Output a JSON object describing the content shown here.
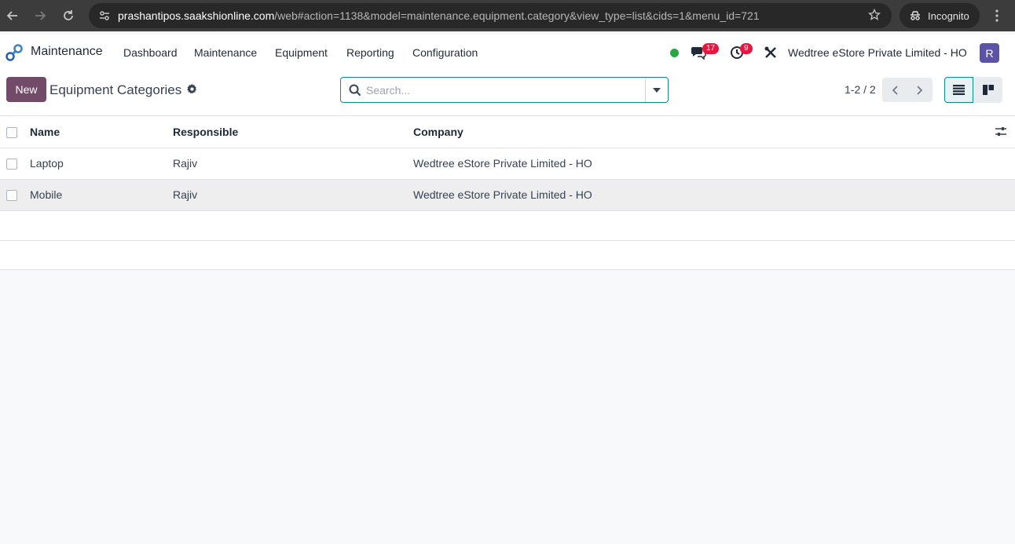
{
  "browser": {
    "url_host": "prashantipos.saakshionline.com",
    "url_path": "/web#action=1138&model=maintenance.equipment.category&view_type=list&cids=1&menu_id=721",
    "incognito_label": "Incognito"
  },
  "topnav": {
    "app_name": "Maintenance",
    "menu": [
      "Dashboard",
      "Maintenance",
      "Equipment",
      "Reporting",
      "Configuration"
    ],
    "messages_count": "17",
    "activities_count": "9",
    "company": "Wedtree eStore Private Limited - HO",
    "avatar_initial": "R"
  },
  "control": {
    "new_label": "New",
    "title": "Equipment Categories",
    "search_placeholder": "Search...",
    "pager": "1-2 / 2"
  },
  "table": {
    "columns": [
      "Name",
      "Responsible",
      "Company"
    ],
    "rows": [
      {
        "name": "Laptop",
        "responsible": "Rajiv",
        "company": "Wedtree eStore Private Limited - HO"
      },
      {
        "name": "Mobile",
        "responsible": "Rajiv",
        "company": "Wedtree eStore Private Limited - HO"
      }
    ]
  },
  "colors": {
    "primary": "#714b67",
    "accent": "#0f8a8f",
    "badge": "#e5173f",
    "avatar": "#5b53a8"
  }
}
